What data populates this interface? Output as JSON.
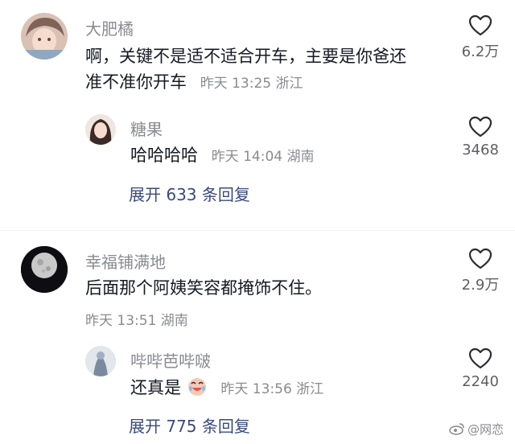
{
  "comments": [
    {
      "username": "大肥橘",
      "text_line1": "啊，关键不是适不适合开车，主要是你爸还",
      "text_line2": "准不准你开车",
      "meta": "昨天 13:25 浙江",
      "likes": "6.2万",
      "avatar_icon": "anime-girl-avatar"
    },
    {
      "username": "糖果",
      "text": "哈哈哈哈",
      "meta": "昨天 14:04 湖南",
      "likes": "3468",
      "avatar_icon": "girl-photo-avatar"
    },
    {
      "expand": "展开 633 条回复"
    },
    {
      "username": "幸福铺满地",
      "text": "后面那个阿姨笑容都掩饰不住。",
      "meta": "昨天 13:51 湖南",
      "likes": "2.9万",
      "avatar_icon": "moon-avatar"
    },
    {
      "username": "哔哔芭哔啵",
      "text": "还真是",
      "emoji": "laughing-cry-emoji",
      "meta": "昨天 13:56 浙江",
      "likes": "2240",
      "avatar_icon": "figure-avatar"
    },
    {
      "expand": "展开 775 条回复"
    }
  ],
  "watermark": "@网恋",
  "colors": {
    "text": "#161823",
    "muted": "#8a8b91",
    "link": "#3a4a7c"
  }
}
